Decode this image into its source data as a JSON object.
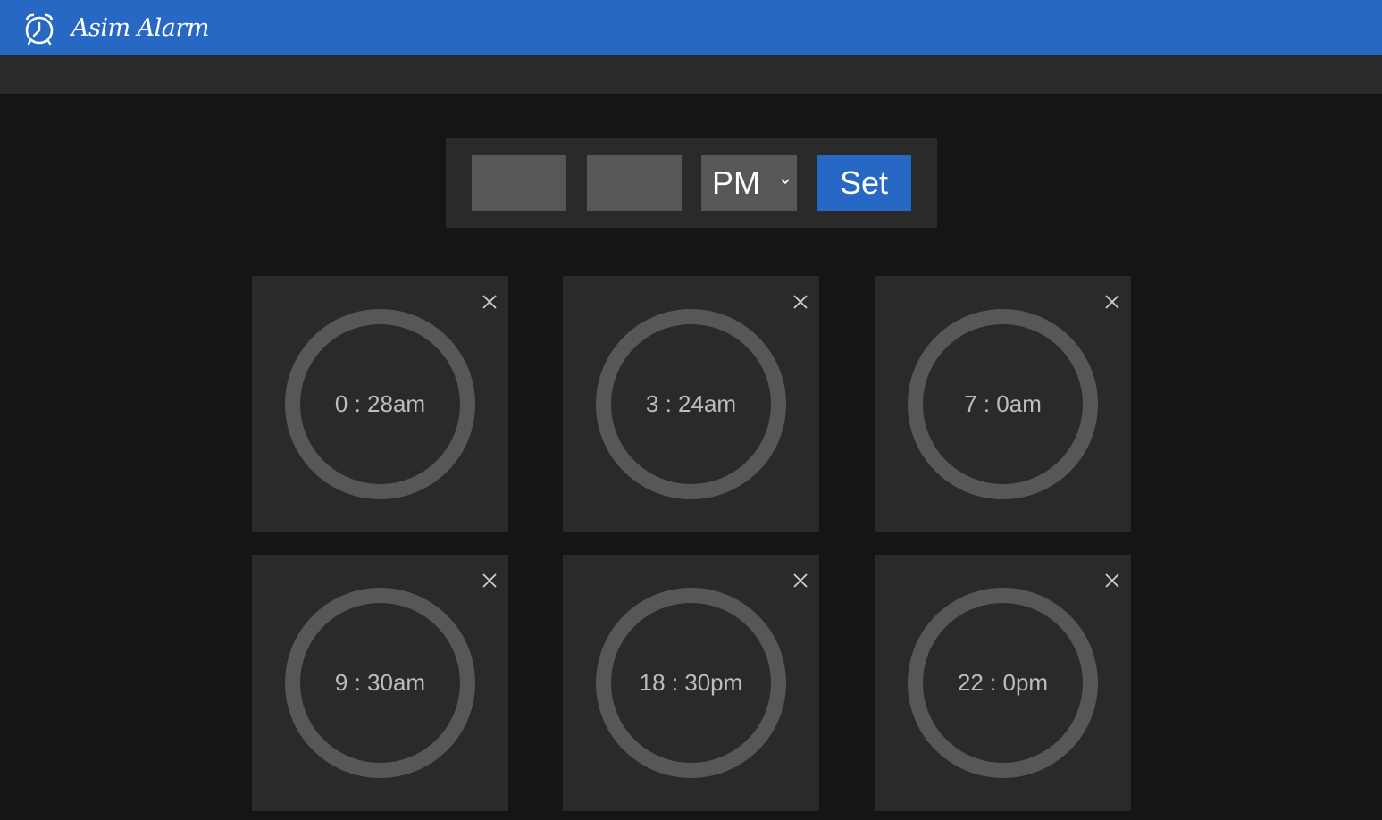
{
  "app": {
    "title": "Asim Alarm",
    "logo_icon": "alarm-clock-icon",
    "accent_color": "#2768c5"
  },
  "setter": {
    "hour_value": "",
    "minute_value": "",
    "ampm_selected": "PM",
    "ampm_icon": "chevron-down-icon",
    "set_label": "Set"
  },
  "alarms": [
    {
      "time": "0 : 28am",
      "close_icon": "close-icon"
    },
    {
      "time": "3 : 24am",
      "close_icon": "close-icon"
    },
    {
      "time": "7 : 0am",
      "close_icon": "close-icon"
    },
    {
      "time": "9 : 30am",
      "close_icon": "close-icon"
    },
    {
      "time": "18 : 30pm",
      "close_icon": "close-icon"
    },
    {
      "time": "22 : 0pm",
      "close_icon": "close-icon"
    }
  ]
}
